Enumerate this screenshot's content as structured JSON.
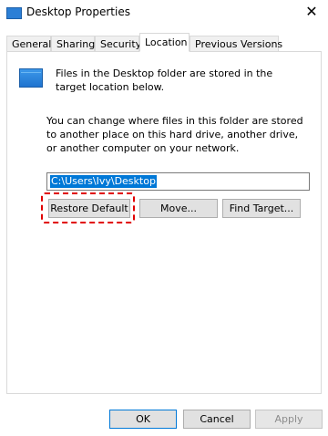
{
  "window": {
    "title": "Desktop Properties",
    "close_glyph": "✕"
  },
  "tabs": [
    {
      "label": "General",
      "active": false
    },
    {
      "label": "Sharing",
      "active": false
    },
    {
      "label": "Security",
      "active": false
    },
    {
      "label": "Location",
      "active": true
    },
    {
      "label": "Previous Versions",
      "active": false
    }
  ],
  "location": {
    "info": "Files in the Desktop folder are stored in the target location below.",
    "description": "You can change where files in this folder are stored to another place on this hard drive, another drive, or another computer on your network.",
    "path_value": "C:\\Users\\Ivy\\Desktop",
    "buttons": {
      "restore_label": "Restore Default",
      "move_label": "Move...",
      "find_label": "Find Target..."
    }
  },
  "footer": {
    "ok_label": "OK",
    "cancel_label": "Cancel",
    "apply_label": "Apply"
  },
  "colors": {
    "selection": "#0078d7",
    "highlight_outline": "#e00000",
    "folder_icon": "#2b7fd6"
  }
}
